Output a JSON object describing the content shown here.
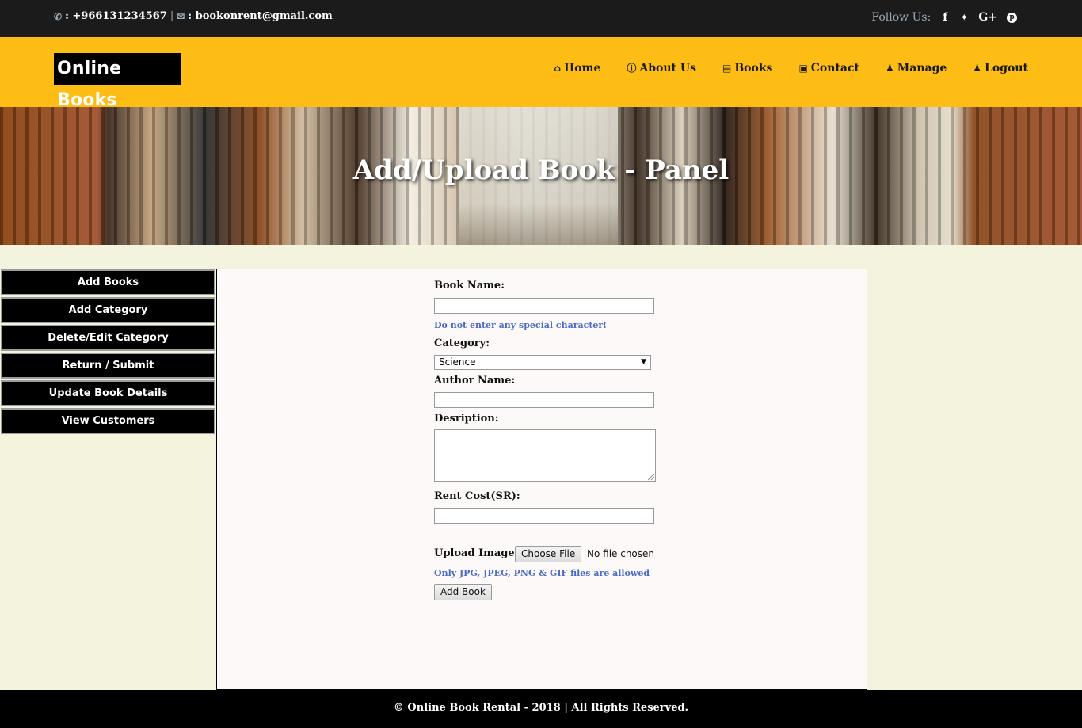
{
  "topbar": {
    "phone_icon": "phone-icon",
    "phone": ": +966131234567",
    "separator": "|",
    "email_icon": "envelope-icon",
    "email": ": bookonrent@gmail.com",
    "follow_label": "Follow Us:",
    "social": [
      {
        "icon": "facebook-icon",
        "glyph": "f"
      },
      {
        "icon": "twitter-icon",
        "glyph": "🐦"
      },
      {
        "icon": "google-plus-icon",
        "glyph": "G+"
      },
      {
        "icon": "pinterest-icon",
        "glyph": "p"
      }
    ]
  },
  "navbar": {
    "logo": "Online Books",
    "items": [
      {
        "label": "Home",
        "icon": "home-icon"
      },
      {
        "label": "About Us",
        "icon": "info-icon"
      },
      {
        "label": "Books",
        "icon": "book-icon"
      },
      {
        "label": "Contact",
        "icon": "contact-icon"
      },
      {
        "label": "Manage",
        "icon": "user-icon"
      },
      {
        "label": "Logout",
        "icon": "user-icon"
      }
    ]
  },
  "banner": {
    "title": "Add/Upload Book - Panel"
  },
  "sidebar": {
    "items": [
      "Add Books",
      "Add Category",
      "Delete/Edit Category",
      "Return / Submit",
      "Update Book Details",
      "View Customers"
    ]
  },
  "form": {
    "book_name_label": "Book Name:",
    "book_name_value": "",
    "book_name_hint": "Do not enter any special character!",
    "category_label": "Category:",
    "category_selected": "Science",
    "author_label": "Author Name:",
    "author_value": "",
    "description_label": "Desription:",
    "description_value": "",
    "rent_cost_label": "Rent Cost(SR):",
    "rent_cost_value": "",
    "upload_label": "Upload Image:",
    "choose_file_label": "Choose File",
    "no_file_text": "No file chosen",
    "upload_hint": "Only JPG, JPEG, PNG & GIF files are allowed",
    "submit_label": "Add Book"
  },
  "footer": {
    "text": "© Online Book Rental - 2018 | All Rights Reserved."
  }
}
